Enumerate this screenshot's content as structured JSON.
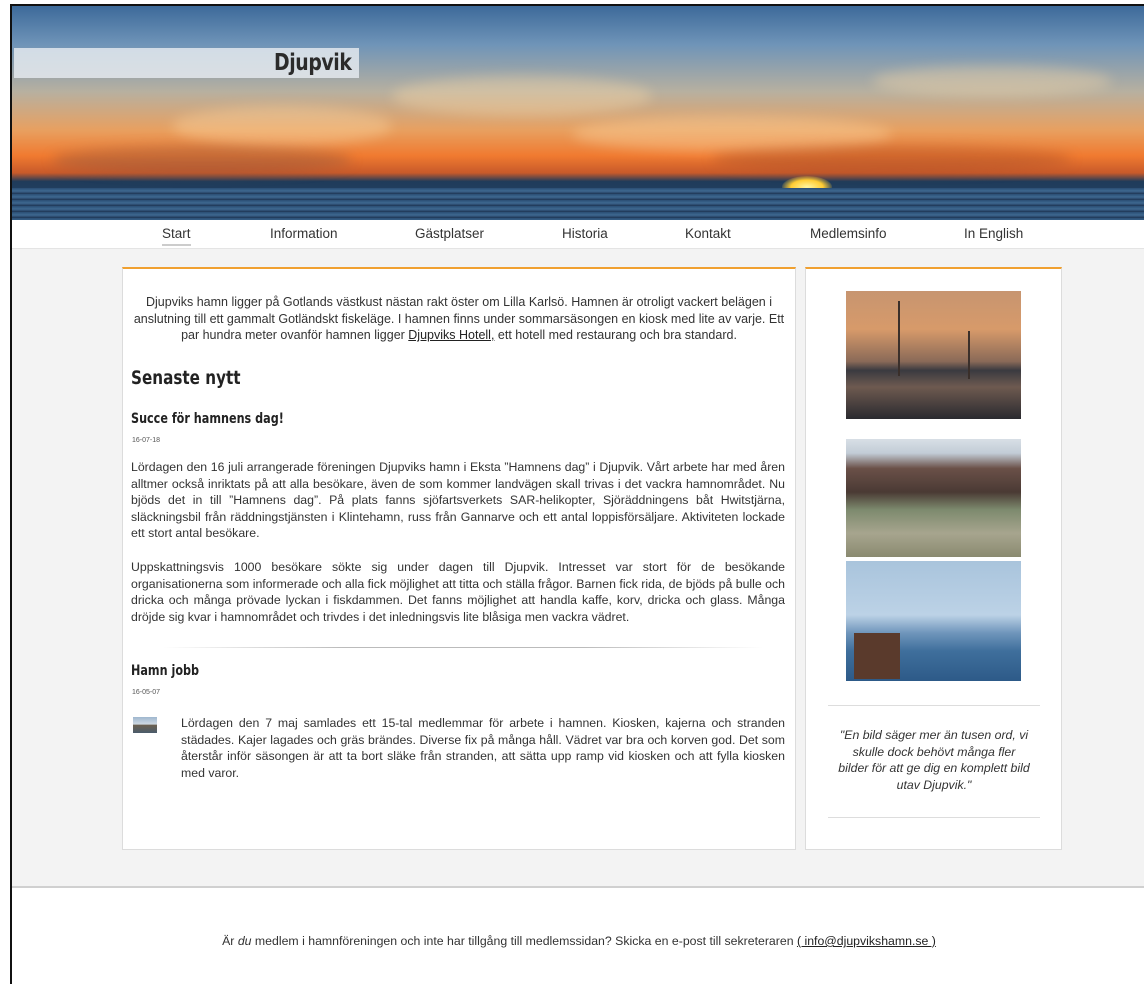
{
  "site": {
    "title": "Djupvik"
  },
  "nav": {
    "items": [
      "Start",
      "Information",
      "Gästplatser",
      "Historia",
      "Kontakt",
      "Medlemsinfo",
      "In English"
    ]
  },
  "intro": {
    "before_link": "Djupviks hamn ligger på Gotlands västkust nästan rakt öster om Lilla Karlsö. Hamnen är otroligt vackert belägen i anslutning till ett gammalt Gotländskt fiskeläge. I hamnen finns under sommarsäsongen en kiosk med lite av varje. Ett par hundra meter ovanför hamnen ligger ",
    "link": "Djupviks Hotell,",
    "after_link": " ett hotell med restaurang och bra standard."
  },
  "news": {
    "heading": "Senaste nytt",
    "posts": [
      {
        "title": "Succe för hamnens dag!",
        "date": "16-07-18",
        "paragraphs": [
          "Lördagen den 16 juli arrangerade föreningen Djupviks hamn i Eksta ”Hamnens dag” i Djupvik. Vårt arbete har med åren alltmer också inriktats på att alla besökare, även de som kommer landvägen skall trivas i det vackra hamnområdet. Nu bjöds det in till ”Hamnens dag”. På plats fanns sjöfartsverkets SAR-helikopter, Sjöräddningens båt Hwitstjärna, släckningsbil från räddningstjänsten i Klintehamn, russ från Gannarve och ett antal loppisförsäljare. Aktiviteten lockade ett stort antal besökare.",
          "Uppskattningsvis 1000 besökare sökte sig under dagen till Djupvik. Intresset var stort för de besökande organisationerna som informerade och alla fick möjlighet att titta och ställa frågor. Barnen fick rida, de bjöds på bulle och dricka och många prövade lyckan i fiskdammen. Det fanns möjlighet att handla kaffe, korv, dricka och glass. Många dröjde sig kvar i hamnområdet och trivdes i det inledningsvis lite blåsiga men vackra vädret."
        ]
      },
      {
        "title": "Hamn jobb",
        "date": "16-05-07",
        "paragraphs": [
          "Lördagen den 7 maj samlades ett 15-tal medlemmar för arbete i hamnen. Kiosken, kajerna och stranden städades. Kajer lagades och gräs brändes. Diverse fix på många håll. Vädret var bra och korven god. Det som återstår inför säsongen är att ta bort släke från stranden, att sätta upp ramp vid kiosken och att fylla kiosken med varor."
        ]
      }
    ]
  },
  "sidebar": {
    "quote": "\"En bild säger mer än tusen ord, vi skulle dock behövt många fler bilder för att ge dig en komplett bild utav Djupvik.\""
  },
  "footer": {
    "text_before": "Är ",
    "text_em": "du",
    "text_after": " medlem i hamnföreningen och inte har tillgång till medlemssidan? Skicka en e-post till sekreteraren ",
    "email_link": "( info@djupvikshamn.se )"
  }
}
